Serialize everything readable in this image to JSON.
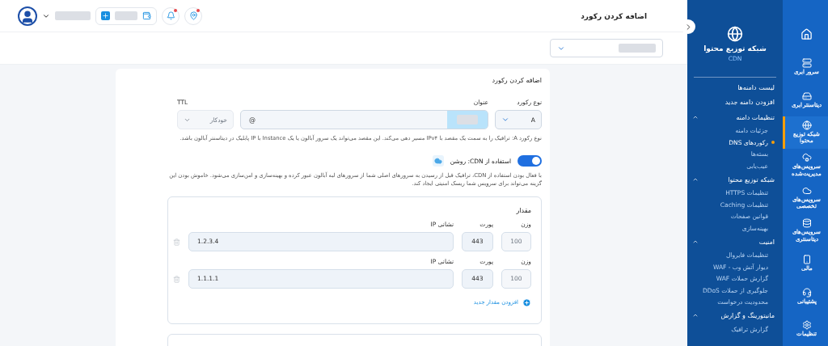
{
  "header": {
    "title": "اضافه کردن رکورد",
    "alerts": [
      {
        "kind": "bell",
        "unread": true
      },
      {
        "kind": "pin",
        "unread": true
      }
    ]
  },
  "form": {
    "title": "اضافه کردن رکورد",
    "record_type": {
      "label": "نوع رکورد",
      "value": "A"
    },
    "name": {
      "label": "عنوان",
      "value": "@"
    },
    "ttl": {
      "label": "TTL",
      "value": "خودکار",
      "disabled": true
    },
    "record_help": "نوع رکورد A: ترافیک را به سمت یک مقصد با IPv۴ مسیر دهی می‌کند. این مقصد می‌تواند یک سرور آبالون یا یک Instance با IP پابلیک در دیتاسنتر آبالون باشد.",
    "cdn": {
      "label": "استفاده از CDN: روشن",
      "on": true,
      "help": "با فعال بودن استفاده از CDN، ترافیک قبل از رسیدن به سرورهای اصلی شما از سرورهای لبه آبالون عبور کرده و بهینه‌سازی و امن‌سازی می‌شود. خاموش بودن این گزینه می‌تواند برای سرویس شما ریسک امنیتی ایجاد کند."
    },
    "values": {
      "title": "مقدار",
      "rows": [
        {
          "weight": {
            "label": "وزن",
            "value": "100",
            "disabled": true
          },
          "port": {
            "label": "پورت",
            "value": "443",
            "disabled": false
          },
          "ip": {
            "label": "نشانی IP",
            "value": "1.2.3.4",
            "disabled": false
          }
        },
        {
          "weight": {
            "label": "وزن",
            "value": "100",
            "disabled": true
          },
          "port": {
            "label": "پورت",
            "value": "443",
            "disabled": false
          },
          "ip": {
            "label": "نشانی IP",
            "value": "1.1.1.1",
            "disabled": false
          }
        }
      ],
      "add_label": "افزودن مقدار جدید"
    }
  },
  "panel": {
    "title": "شبکه توزیع محتوا",
    "subtitle": "CDN",
    "items": [
      {
        "kind": "link",
        "label": "لیست دامنه‌ها",
        "selected": false
      },
      {
        "kind": "link",
        "label": "افزودن دامنه جدید",
        "selected": false
      },
      {
        "kind": "group",
        "label": "تنظیمات دامنه",
        "expanded": true,
        "children": [
          {
            "label": "جزئیات دامنه",
            "selected": false
          },
          {
            "label": "رکوردهای DNS",
            "selected": true
          },
          {
            "label": "بسته‌ها",
            "selected": false
          },
          {
            "label": "عیب‌یابی",
            "selected": false
          }
        ]
      },
      {
        "kind": "group",
        "label": "شبکه توزیع محتوا",
        "expanded": true,
        "children": [
          {
            "label": "تنظیمات HTTPS",
            "selected": false
          },
          {
            "label": "تنظیمات Caching",
            "selected": false
          },
          {
            "label": "قوانین صفحات",
            "selected": false
          },
          {
            "label": "بهینه‌سازی",
            "selected": false
          }
        ]
      },
      {
        "kind": "group",
        "label": "امنیت",
        "expanded": true,
        "children": [
          {
            "label": "تنظیمات فایروال",
            "selected": false
          },
          {
            "label": "دیوار آتش وب - WAF",
            "selected": false
          },
          {
            "label": "گزارش حملات WAF",
            "selected": false
          },
          {
            "label": "جلوگیری از حملات DDoS",
            "selected": false
          },
          {
            "label": "محدودیت درخواست",
            "selected": false
          }
        ]
      },
      {
        "kind": "group",
        "label": "مانیتورینگ و گزارش",
        "expanded": true,
        "children": [
          {
            "label": "گزارش ترافیک",
            "selected": false
          }
        ]
      }
    ]
  },
  "rail": [
    {
      "kind": "home",
      "selected": false
    },
    {
      "kind": "server",
      "label": "سرور ابری",
      "selected": false
    },
    {
      "kind": "datacenter",
      "label": "دیتاسنتر ابری",
      "selected": false
    },
    {
      "kind": "globe",
      "label": "شبکه توزیع محتوا",
      "selected": true
    },
    {
      "kind": "managed",
      "label": "سرویس‌های مدیریت‌شده",
      "selected": false
    },
    {
      "kind": "special",
      "label": "سرویس‌های تخصصی",
      "selected": false
    },
    {
      "kind": "database",
      "label": "سرویس‌های دیتاسنتری",
      "selected": false
    },
    {
      "kind": "finance",
      "label": "مالی",
      "selected": false
    },
    {
      "kind": "support",
      "label": "پشتیبانی",
      "selected": false
    },
    {
      "kind": "settings",
      "label": "تنظیمات",
      "selected": false
    }
  ]
}
